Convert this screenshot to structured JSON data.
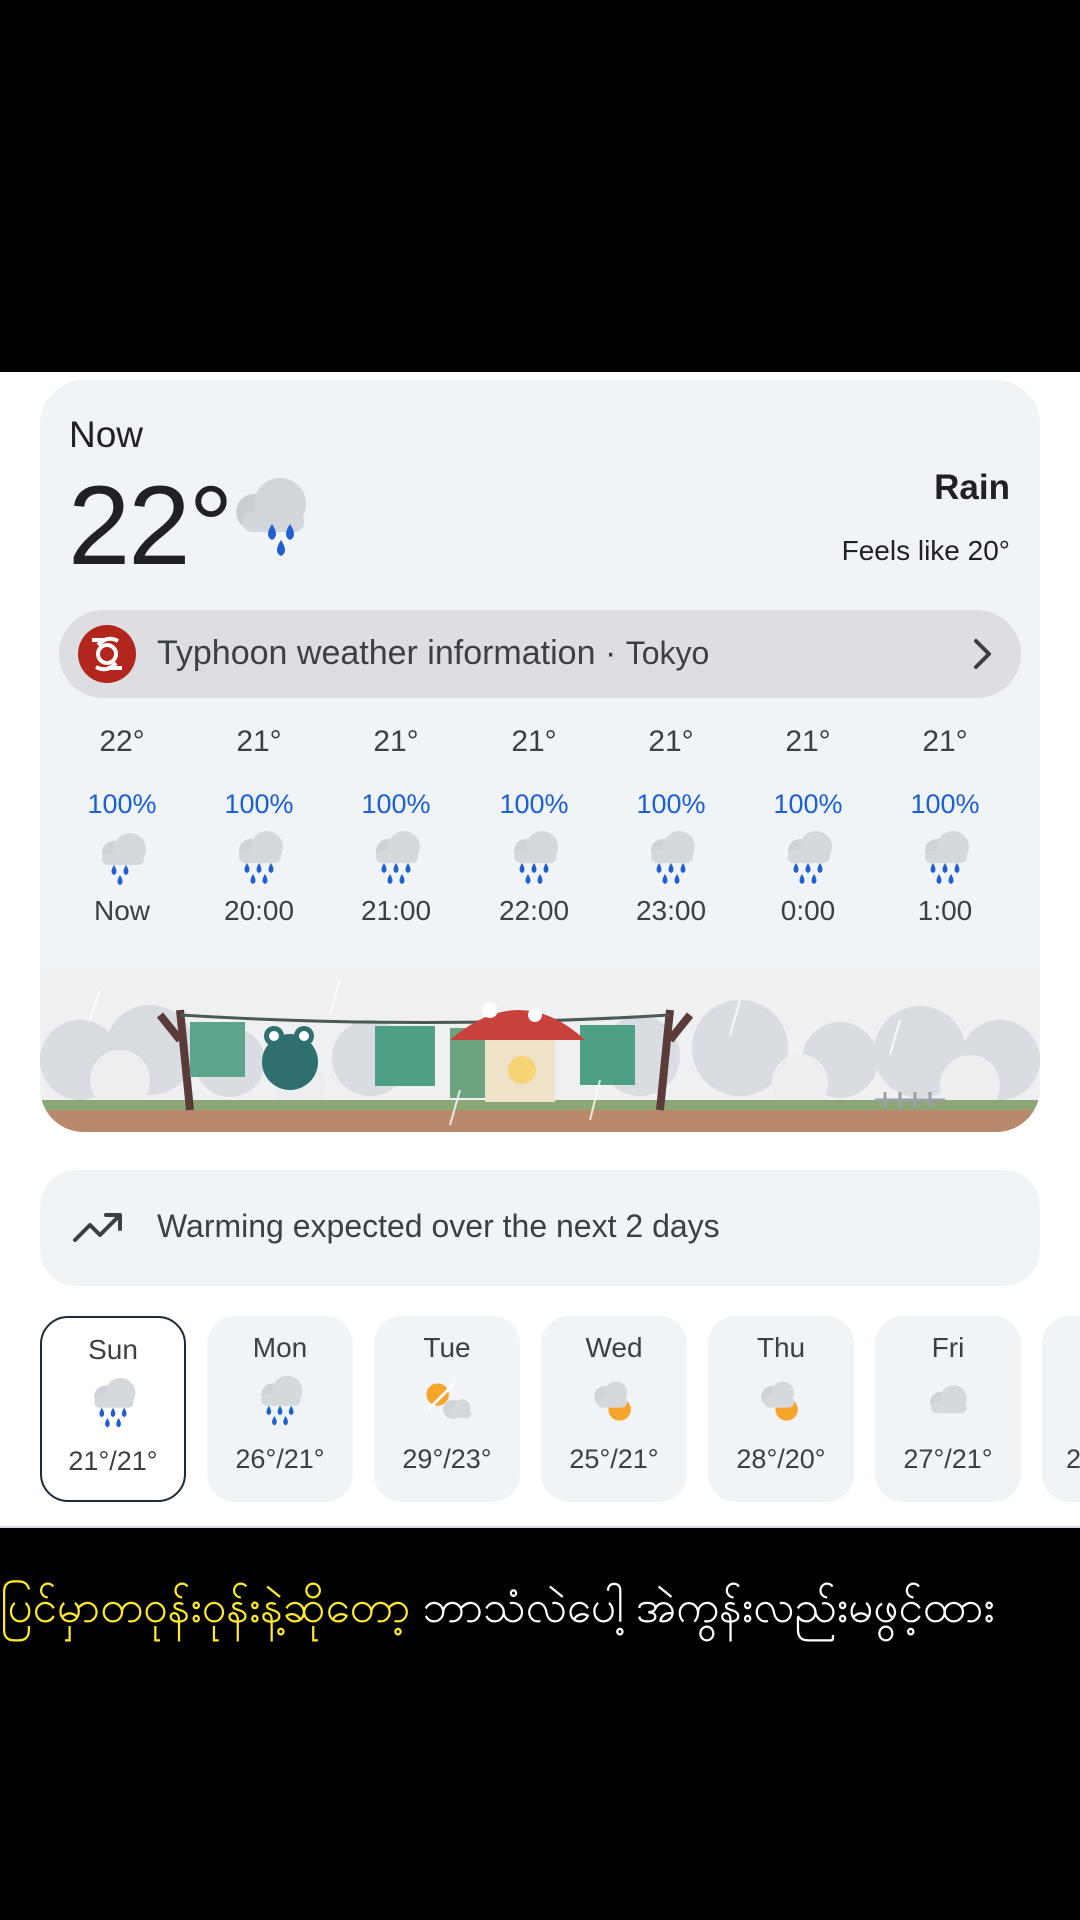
{
  "current": {
    "label": "Now",
    "temperature": "22°",
    "condition": "Rain",
    "feels_like": "Feels like 20°",
    "icon": "rain-cloud-icon"
  },
  "alert": {
    "title": "Typhoon weather information",
    "separator": "·",
    "location": "Tokyo",
    "icon": "typhoon-icon"
  },
  "hourly": [
    {
      "temp": "22°",
      "precip": "100%",
      "time": "Now"
    },
    {
      "temp": "21°",
      "precip": "100%",
      "time": "20:00"
    },
    {
      "temp": "21°",
      "precip": "100%",
      "time": "21:00"
    },
    {
      "temp": "21°",
      "precip": "100%",
      "time": "22:00"
    },
    {
      "temp": "21°",
      "precip": "100%",
      "time": "23:00"
    },
    {
      "temp": "21°",
      "precip": "100%",
      "time": "0:00"
    },
    {
      "temp": "21°",
      "precip": "100%",
      "time": "1:00"
    }
  ],
  "trend": {
    "text": "Warming expected over the next 2 days",
    "icon": "trending-up-icon"
  },
  "daily": [
    {
      "day": "Sun",
      "temps": "21°/21°",
      "icon": "rain-cloud-icon",
      "selected": true
    },
    {
      "day": "Mon",
      "temps": "26°/21°",
      "icon": "rain-cloud-icon"
    },
    {
      "day": "Tue",
      "temps": "29°/23°",
      "icon": "partly-cloudy-icon"
    },
    {
      "day": "Wed",
      "temps": "25°/21°",
      "icon": "cloudy-sun-icon"
    },
    {
      "day": "Thu",
      "temps": "28°/20°",
      "icon": "cloudy-sun-icon"
    },
    {
      "day": "Fri",
      "temps": "27°/21°",
      "icon": "cloudy-icon"
    },
    {
      "day": "",
      "temps": "2",
      "icon": ""
    }
  ],
  "subtitle": {
    "highlight": "ပြင်မှာတဝုန်းဝုန်းနဲ့ဆိုတော့",
    "rest": " ဘာသံလဲပေါ့ အဲကွန်းလည်းမဖွင့်ထား"
  },
  "colors": {
    "precip_blue": "#1a5ed8",
    "rain_drop": "#1f5fd1",
    "card_bg": "#f1f4f7",
    "alert_red": "#b3261e",
    "subtitle_yellow": "#ffe92b"
  }
}
